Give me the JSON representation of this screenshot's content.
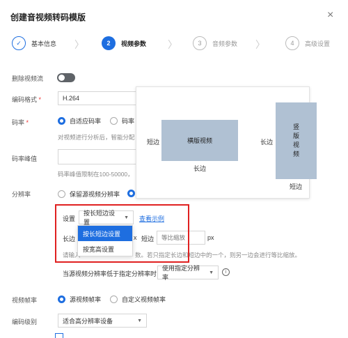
{
  "dialog": {
    "title": "创建音视频转码模版",
    "close_label": "×"
  },
  "steps": [
    {
      "num": "✓",
      "label": "基本信息",
      "state": "done"
    },
    {
      "num": "2",
      "label": "视频参数",
      "state": "active"
    },
    {
      "num": "3",
      "label": "音频参数",
      "state": "todo"
    },
    {
      "num": "4",
      "label": "高级设置",
      "state": "todo"
    }
  ],
  "form": {
    "delete_video": {
      "label": "删除视频流"
    },
    "codec": {
      "label": "编码格式",
      "required": "*",
      "value": "H.264"
    },
    "bitrate": {
      "label": "码率",
      "required": "*",
      "option_adaptive": "自适应码率",
      "option_other": "码率",
      "hint": "对视频进行分析后，智能分配"
    },
    "peak": {
      "label": "码率峰值",
      "hint": "码率峰值限制在100-50000，"
    },
    "resolution": {
      "label": "分辨率",
      "option_keep": "保留源视频分辨率",
      "setting_label": "设置",
      "setting_value": "按长短边设置",
      "example_link": "查看示例",
      "long_label": "长边",
      "long_unit": "x",
      "short_label": "短边",
      "short_placeholder": "等比缩放",
      "unit": "px",
      "hint_prefix": "请输入",
      "hint_suffix": "数。若只指定长边和短边中的一个，则另一边会进行等比缩放。",
      "fallback_label": "当源视频分辨率低于指定分辨率时",
      "fallback_value": "使用指定分辨率",
      "info_icon": "i"
    },
    "framerate": {
      "label": "视频帧率",
      "option_source": "源视频帧率",
      "option_custom": "自定义视频帧率"
    },
    "level": {
      "label": "编码级别",
      "value": "适合高分辨率设备"
    }
  },
  "dropdown": {
    "options": [
      "按长短边设置",
      "按宽高设置"
    ],
    "selected_index": 0
  },
  "tooltip": {
    "landscape": {
      "text": "横版视频",
      "left": "短边",
      "bottom": "长边"
    },
    "portrait": {
      "text": "竖版视频",
      "left": "长边",
      "bottom": "短边"
    }
  },
  "colors": {
    "accent": "#1e6ee0",
    "highlight": "#e02020",
    "video_box": "#b0c1d3"
  }
}
